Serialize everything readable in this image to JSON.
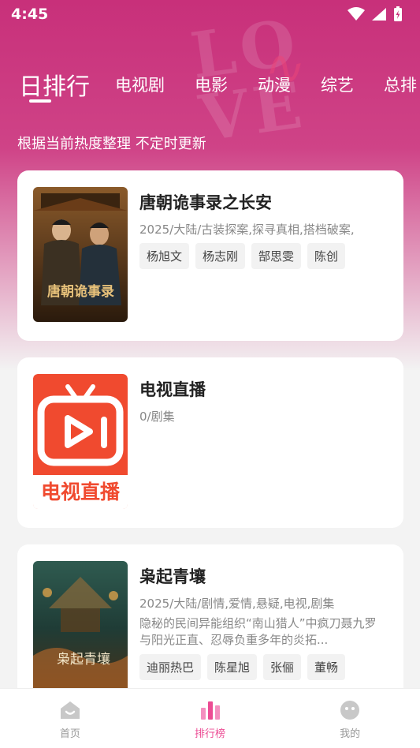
{
  "status_bar": {
    "time": "4:45"
  },
  "tabs": [
    {
      "label": "日排行",
      "active": true
    },
    {
      "label": "电视剧"
    },
    {
      "label": "电影"
    },
    {
      "label": "动漫"
    },
    {
      "label": "综艺"
    },
    {
      "label": "总排"
    }
  ],
  "subtitle": "根据当前热度整理 不定时更新",
  "cards": [
    {
      "title": "唐朝诡事录之长安",
      "meta": "2025/大陆/古装探案,探寻真相,搭档破案,",
      "poster_title": "唐朝诡事录",
      "tags": [
        "杨旭文",
        "杨志刚",
        "郜思雯",
        "陈创"
      ]
    },
    {
      "title": "电视直播",
      "meta": "0/剧集",
      "poster_title": "电视直播"
    },
    {
      "title": "枭起青壤",
      "meta": "2025/大陆/剧情,爱情,悬疑,电视,剧集",
      "desc": "隐秘的民间异能组织“南山猎人”中疯刀聂九罗与阳光正直、忍辱负重多年的炎拓...",
      "poster_title": "枭起青壤",
      "tags": [
        "迪丽热巴",
        "陈星旭",
        "张俪",
        "董畅"
      ]
    }
  ],
  "bottom_nav": [
    {
      "label": "首页",
      "icon": "home-icon"
    },
    {
      "label": "排行榜",
      "icon": "chart-icon",
      "active": true
    },
    {
      "label": "我的",
      "icon": "profile-icon"
    }
  ],
  "colors": {
    "accent": "#ec4c94",
    "hero_top": "#c8307a",
    "tv_red": "#f04a2f"
  }
}
